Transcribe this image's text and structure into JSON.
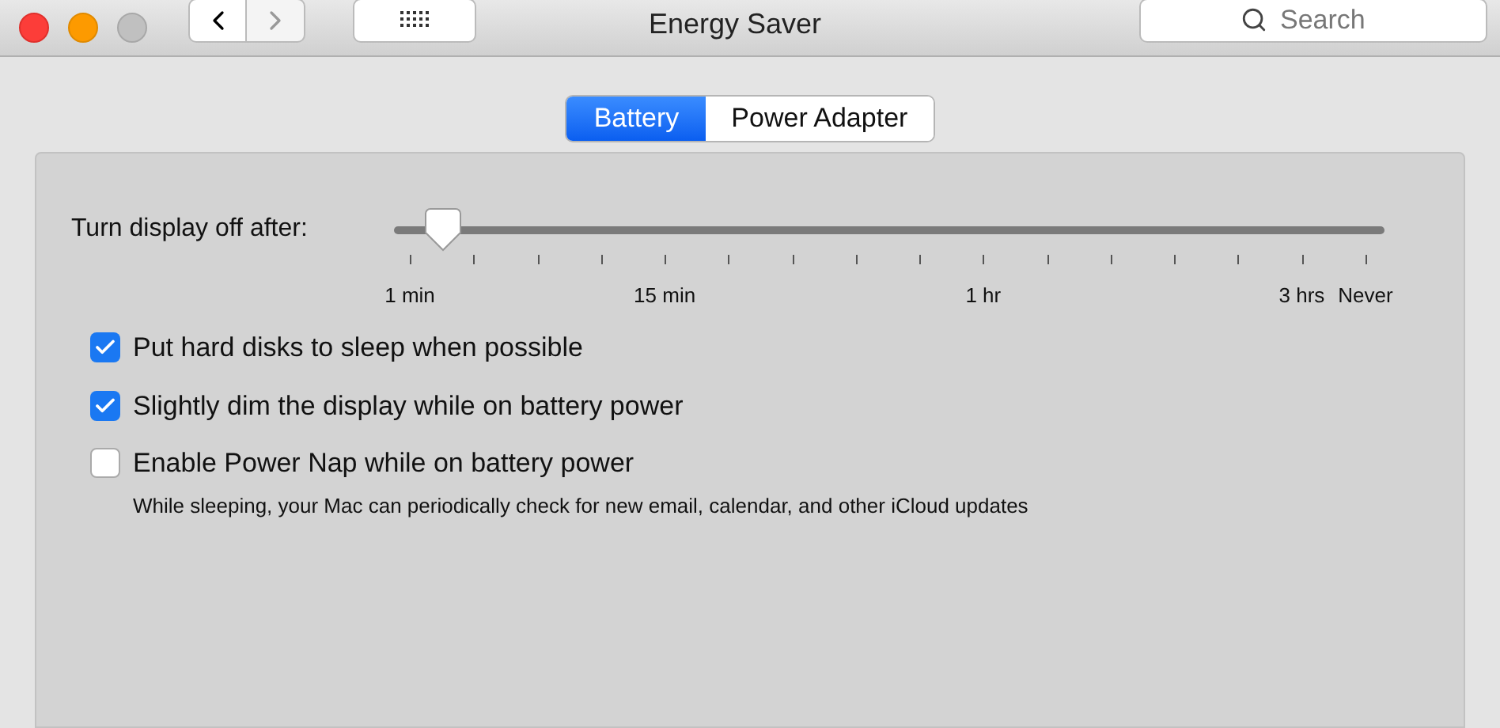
{
  "window": {
    "title": "Energy Saver"
  },
  "toolbar": {
    "search": {
      "placeholder": "Search"
    }
  },
  "tabs": [
    {
      "label": "Battery",
      "selected": true
    },
    {
      "label": "Power Adapter",
      "selected": false
    }
  ],
  "display_slider": {
    "label": "Turn display off after:",
    "level": 0.05,
    "tick_labels": [
      "1 min",
      "15 min",
      "1 hr",
      "3 hrs",
      "Never"
    ]
  },
  "options": [
    {
      "label": "Put hard disks to sleep when possible",
      "checked": true
    },
    {
      "label": "Slightly dim the display while on battery power",
      "checked": true
    },
    {
      "label": "Enable Power Nap while on battery power",
      "checked": false,
      "description": "While sleeping, your Mac can periodically check for new email, calendar, and other iCloud updates"
    }
  ]
}
